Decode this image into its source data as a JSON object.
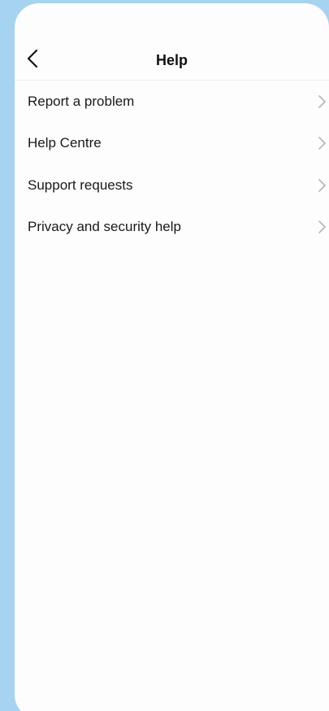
{
  "header": {
    "title": "Help",
    "back_icon": "chevron-left-icon"
  },
  "menu": {
    "items": [
      {
        "label": "Report a problem",
        "icon": "chevron-right-icon"
      },
      {
        "label": "Help Centre",
        "icon": "chevron-right-icon"
      },
      {
        "label": "Support requests",
        "icon": "chevron-right-icon"
      },
      {
        "label": "Privacy and security help",
        "icon": "chevron-right-icon"
      }
    ]
  },
  "colors": {
    "background": "#a6d3ef",
    "surface": "#fdfdfe",
    "text": "#1a1a1a",
    "chevron": "#b5b5b5"
  }
}
